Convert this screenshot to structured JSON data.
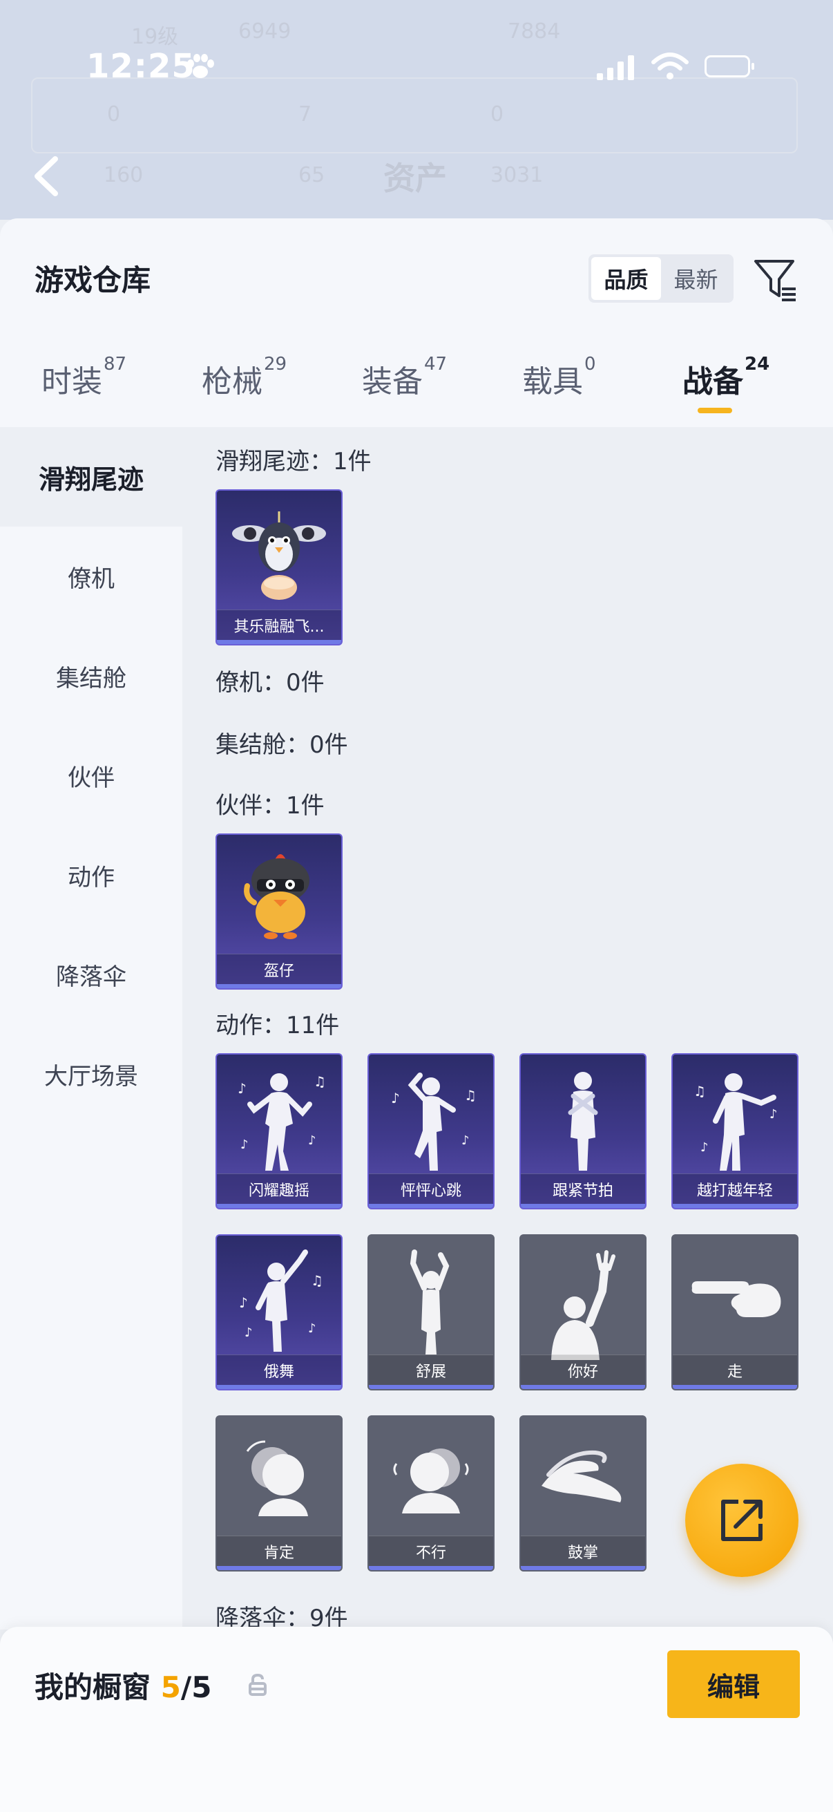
{
  "status_bar": {
    "time": "12:25"
  },
  "background": {
    "ghost_values": [
      "19级",
      "6949",
      "7884",
      "0",
      "7",
      "0",
      "160",
      "65",
      "3031"
    ],
    "ghost_title": "资产"
  },
  "header": {
    "title": "游戏仓库",
    "sort_options": [
      "品质",
      "最新"
    ],
    "sort_selected": "品质"
  },
  "tabs": [
    {
      "label": "时装",
      "count": "87"
    },
    {
      "label": "枪械",
      "count": "29"
    },
    {
      "label": "装备",
      "count": "47"
    },
    {
      "label": "载具",
      "count": "0"
    },
    {
      "label": "战备",
      "count": "24"
    }
  ],
  "active_tab": "战备",
  "categories": [
    "滑翔尾迹",
    "僚机",
    "集结舱",
    "伙伴",
    "动作",
    "降落伞",
    "大厅场景"
  ],
  "active_category": "滑翔尾迹",
  "sections": [
    {
      "title": "滑翔尾迹：1件",
      "items": [
        {
          "name": "其乐融融飞...",
          "style": "purple",
          "icon": "penguin-balloon-icon"
        }
      ]
    },
    {
      "title": "僚机：0件",
      "items": []
    },
    {
      "title": "集结舱：0件",
      "items": []
    },
    {
      "title": "伙伴：1件",
      "items": [
        {
          "name": "盔仔",
          "style": "purple",
          "icon": "helmet-chick-icon"
        }
      ]
    },
    {
      "title": "动作：11件",
      "items": [
        {
          "name": "闪耀趣摇",
          "style": "purple",
          "icon": "dance-pose-icon"
        },
        {
          "name": "怦怦心跳",
          "style": "purple",
          "icon": "dance-pose-icon"
        },
        {
          "name": "跟紧节拍",
          "style": "purple",
          "icon": "dance-pose-icon"
        },
        {
          "name": "越打越年轻",
          "style": "purple",
          "icon": "dance-pose-icon"
        },
        {
          "name": "俄舞",
          "style": "purple",
          "icon": "dance-pose-icon"
        },
        {
          "name": "舒展",
          "style": "gray",
          "icon": "stretch-pose-icon"
        },
        {
          "name": "你好",
          "style": "gray",
          "icon": "wave-hand-icon"
        },
        {
          "name": "走",
          "style": "gray",
          "icon": "pointing-hand-icon"
        },
        {
          "name": "肯定",
          "style": "gray",
          "icon": "nod-head-icon"
        },
        {
          "name": "不行",
          "style": "gray",
          "icon": "shake-head-icon"
        },
        {
          "name": "鼓掌",
          "style": "gray",
          "icon": "clap-hands-icon"
        }
      ]
    },
    {
      "title": "降落伞：9件",
      "items": []
    }
  ],
  "showcase": {
    "label": "我的橱窗",
    "current": "5",
    "total": "/5",
    "edit_label": "编辑"
  },
  "colors": {
    "accent": "#f7b519",
    "purple_card": "#403a8c",
    "gray_card": "#5d6170",
    "rarity_bar": "#6f7ae6"
  }
}
